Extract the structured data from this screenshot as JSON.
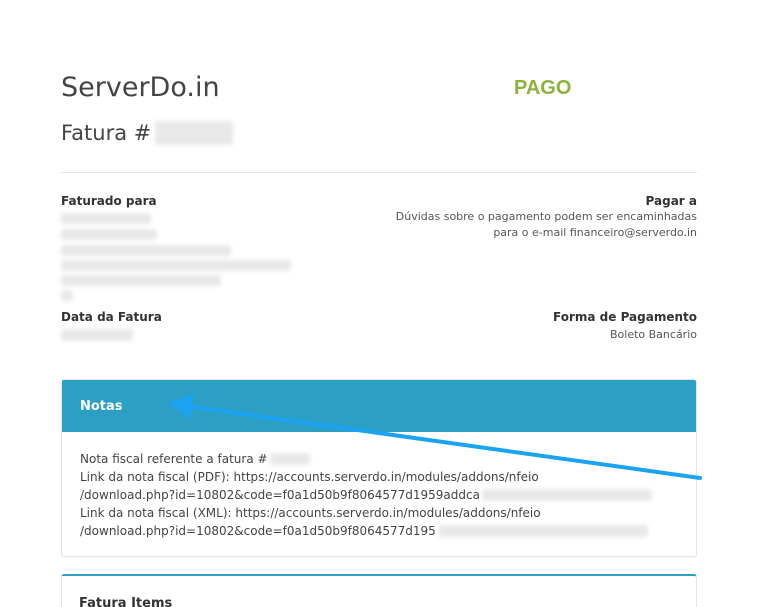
{
  "header": {
    "brand": "ServerDo.in",
    "status": "PAGO",
    "invoice_prefix": "Fatura #"
  },
  "billed_to": {
    "label": "Faturado para"
  },
  "pay_to": {
    "label": "Pagar a",
    "line1": "Dúvidas sobre o pagamento podem ser encaminhadas",
    "line2": "para o e-mail financeiro@serverdo.in"
  },
  "invoice_date": {
    "label": "Data da Fatura"
  },
  "payment_method": {
    "label": "Forma de Pagamento",
    "value": "Boleto Bancário"
  },
  "notes": {
    "title": "Notas",
    "line1": "Nota fiscal referente a fatura #",
    "line2": "Link da nota fiscal (PDF): https://accounts.serverdo.in/modules/addons/nfeio",
    "line3": "/download.php?id=10802&code=f0a1d50b9f8064577d1959addca",
    "line4": "Link da nota fiscal (XML): https://accounts.serverdo.in/modules/addons/nfeio",
    "line5": "/download.php?id=10802&code=f0a1d50b9f8064577d195"
  },
  "items": {
    "title": "Fatura Items"
  },
  "colors": {
    "accent": "#2e9fc4",
    "paid": "#8bb33a",
    "annotation_arrow": "#1aa3f0"
  }
}
